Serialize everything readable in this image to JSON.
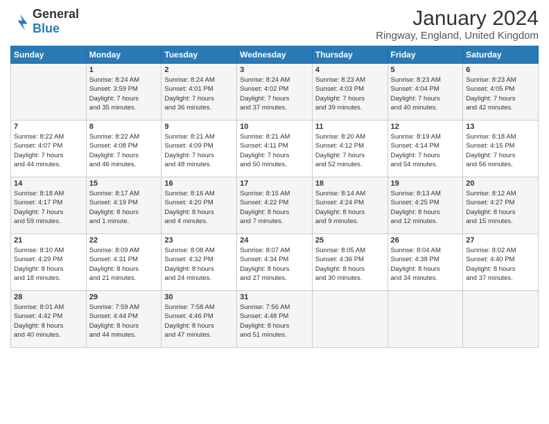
{
  "logo": {
    "general": "General",
    "blue": "Blue"
  },
  "title": "January 2024",
  "location": "Ringway, England, United Kingdom",
  "headers": [
    "Sunday",
    "Monday",
    "Tuesday",
    "Wednesday",
    "Thursday",
    "Friday",
    "Saturday"
  ],
  "weeks": [
    [
      {
        "day": "",
        "info": ""
      },
      {
        "day": "1",
        "info": "Sunrise: 8:24 AM\nSunset: 3:59 PM\nDaylight: 7 hours\nand 35 minutes."
      },
      {
        "day": "2",
        "info": "Sunrise: 8:24 AM\nSunset: 4:01 PM\nDaylight: 7 hours\nand 36 minutes."
      },
      {
        "day": "3",
        "info": "Sunrise: 8:24 AM\nSunset: 4:02 PM\nDaylight: 7 hours\nand 37 minutes."
      },
      {
        "day": "4",
        "info": "Sunrise: 8:23 AM\nSunset: 4:03 PM\nDaylight: 7 hours\nand 39 minutes."
      },
      {
        "day": "5",
        "info": "Sunrise: 8:23 AM\nSunset: 4:04 PM\nDaylight: 7 hours\nand 40 minutes."
      },
      {
        "day": "6",
        "info": "Sunrise: 8:23 AM\nSunset: 4:05 PM\nDaylight: 7 hours\nand 42 minutes."
      }
    ],
    [
      {
        "day": "7",
        "info": "Sunrise: 8:22 AM\nSunset: 4:07 PM\nDaylight: 7 hours\nand 44 minutes."
      },
      {
        "day": "8",
        "info": "Sunrise: 8:22 AM\nSunset: 4:08 PM\nDaylight: 7 hours\nand 46 minutes."
      },
      {
        "day": "9",
        "info": "Sunrise: 8:21 AM\nSunset: 4:09 PM\nDaylight: 7 hours\nand 48 minutes."
      },
      {
        "day": "10",
        "info": "Sunrise: 8:21 AM\nSunset: 4:11 PM\nDaylight: 7 hours\nand 50 minutes."
      },
      {
        "day": "11",
        "info": "Sunrise: 8:20 AM\nSunset: 4:12 PM\nDaylight: 7 hours\nand 52 minutes."
      },
      {
        "day": "12",
        "info": "Sunrise: 8:19 AM\nSunset: 4:14 PM\nDaylight: 7 hours\nand 54 minutes."
      },
      {
        "day": "13",
        "info": "Sunrise: 8:18 AM\nSunset: 4:15 PM\nDaylight: 7 hours\nand 56 minutes."
      }
    ],
    [
      {
        "day": "14",
        "info": "Sunrise: 8:18 AM\nSunset: 4:17 PM\nDaylight: 7 hours\nand 59 minutes."
      },
      {
        "day": "15",
        "info": "Sunrise: 8:17 AM\nSunset: 4:19 PM\nDaylight: 8 hours\nand 1 minute."
      },
      {
        "day": "16",
        "info": "Sunrise: 8:16 AM\nSunset: 4:20 PM\nDaylight: 8 hours\nand 4 minutes."
      },
      {
        "day": "17",
        "info": "Sunrise: 8:15 AM\nSunset: 4:22 PM\nDaylight: 8 hours\nand 7 minutes."
      },
      {
        "day": "18",
        "info": "Sunrise: 8:14 AM\nSunset: 4:24 PM\nDaylight: 8 hours\nand 9 minutes."
      },
      {
        "day": "19",
        "info": "Sunrise: 8:13 AM\nSunset: 4:25 PM\nDaylight: 8 hours\nand 12 minutes."
      },
      {
        "day": "20",
        "info": "Sunrise: 8:12 AM\nSunset: 4:27 PM\nDaylight: 8 hours\nand 15 minutes."
      }
    ],
    [
      {
        "day": "21",
        "info": "Sunrise: 8:10 AM\nSunset: 4:29 PM\nDaylight: 8 hours\nand 18 minutes."
      },
      {
        "day": "22",
        "info": "Sunrise: 8:09 AM\nSunset: 4:31 PM\nDaylight: 8 hours\nand 21 minutes."
      },
      {
        "day": "23",
        "info": "Sunrise: 8:08 AM\nSunset: 4:32 PM\nDaylight: 8 hours\nand 24 minutes."
      },
      {
        "day": "24",
        "info": "Sunrise: 8:07 AM\nSunset: 4:34 PM\nDaylight: 8 hours\nand 27 minutes."
      },
      {
        "day": "25",
        "info": "Sunrise: 8:05 AM\nSunset: 4:36 PM\nDaylight: 8 hours\nand 30 minutes."
      },
      {
        "day": "26",
        "info": "Sunrise: 8:04 AM\nSunset: 4:38 PM\nDaylight: 8 hours\nand 34 minutes."
      },
      {
        "day": "27",
        "info": "Sunrise: 8:02 AM\nSunset: 4:40 PM\nDaylight: 8 hours\nand 37 minutes."
      }
    ],
    [
      {
        "day": "28",
        "info": "Sunrise: 8:01 AM\nSunset: 4:42 PM\nDaylight: 8 hours\nand 40 minutes."
      },
      {
        "day": "29",
        "info": "Sunrise: 7:59 AM\nSunset: 4:44 PM\nDaylight: 8 hours\nand 44 minutes."
      },
      {
        "day": "30",
        "info": "Sunrise: 7:58 AM\nSunset: 4:46 PM\nDaylight: 8 hours\nand 47 minutes."
      },
      {
        "day": "31",
        "info": "Sunrise: 7:56 AM\nSunset: 4:48 PM\nDaylight: 8 hours\nand 51 minutes."
      },
      {
        "day": "",
        "info": ""
      },
      {
        "day": "",
        "info": ""
      },
      {
        "day": "",
        "info": ""
      }
    ]
  ]
}
